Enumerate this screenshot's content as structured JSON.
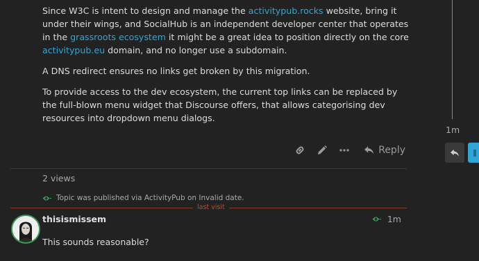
{
  "post": {
    "p1": {
      "t1": "Since W3C is intent to design and manage the ",
      "link1": "activitypub.rocks",
      "t2": " website, bring it under their wings, and SocialHub is an independent developer center that operates in the ",
      "link2": "grassroots ecosystem",
      "t3": " it might be a great idea to position directly on the core ",
      "link3": "activitypub.eu",
      "t4": " domain, and no longer use a subdomain."
    },
    "p2": "A DNS redirect ensures no links get broken by this migration.",
    "p3": "To provide access to the dev ecosystem, the current top links can be replaced by the full-blown menu widget that Discourse offers, that allows categorising dev resources into dropdown menu dialogs.",
    "actions": {
      "link_icon": "link-icon",
      "edit_icon": "pencil-icon",
      "more_icon": "ellipsis-icon",
      "reply_icon": "reply-icon",
      "reply_label": "Reply"
    }
  },
  "views": "2 views",
  "small_action": {
    "icon": "activitypub-icon",
    "text": "Topic was published via ActivityPub on Invalid date."
  },
  "last_visit": "last visit",
  "reply_post": {
    "username": "thisismissem",
    "time": "1m",
    "body": "This sounds reasonable?"
  },
  "timeline": {
    "time": "1m",
    "reply_icon": "reply-icon"
  },
  "colors": {
    "background": "#222222",
    "link": "#2fa6d6",
    "last_visit": "#c44a33",
    "activitypub": "#3aaa6a"
  }
}
